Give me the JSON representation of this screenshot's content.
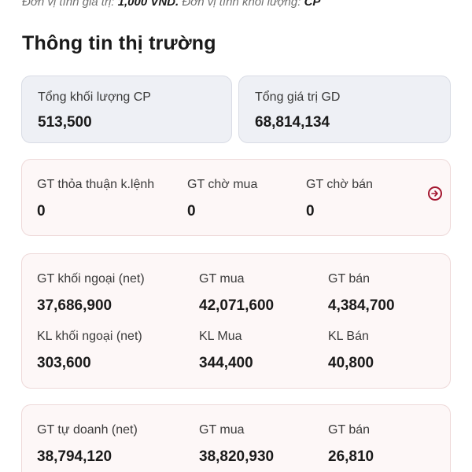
{
  "unit_note": {
    "prefix": "Đơn vị tính giá trị:",
    "value_unit": "1,000 VND.",
    "middle": "Đơn vị tính khối lượng:",
    "volume_unit": "CP"
  },
  "title": "Thông tin thị trường",
  "summary": {
    "volume": {
      "label": "Tổng khối lượng CP",
      "value": "513,500"
    },
    "value": {
      "label": "Tổng giá trị GD",
      "value": "68,814,134"
    }
  },
  "pending": {
    "agreement": {
      "label": "GT thỏa thuận k.lệnh",
      "value": "0"
    },
    "buy_wait": {
      "label": "GT chờ mua",
      "value": "0"
    },
    "sell_wait": {
      "label": "GT chờ bán",
      "value": "0"
    },
    "more_icon": "arrow-right-circle-icon"
  },
  "foreign": {
    "gt_net": {
      "label": "GT khối ngoại (net)",
      "value": "37,686,900"
    },
    "gt_buy": {
      "label": "GT mua",
      "value": "42,071,600"
    },
    "gt_sell": {
      "label": "GT bán",
      "value": "4,384,700"
    },
    "kl_net": {
      "label": "KL khối ngoại (net)",
      "value": "303,600"
    },
    "kl_buy": {
      "label": "KL Mua",
      "value": "344,400"
    },
    "kl_sell": {
      "label": "KL Bán",
      "value": "40,800"
    }
  },
  "proprietary": {
    "gt_net": {
      "label": "GT tự doanh (net)",
      "value": "38,794,120"
    },
    "gt_buy": {
      "label": "GT mua",
      "value": "38,820,930"
    },
    "gt_sell": {
      "label": "GT bán",
      "value": "26,810"
    }
  },
  "colors": {
    "accent": "#a3152e",
    "grey_card": "#eef0f5",
    "pink_card": "#fdf7f7"
  }
}
